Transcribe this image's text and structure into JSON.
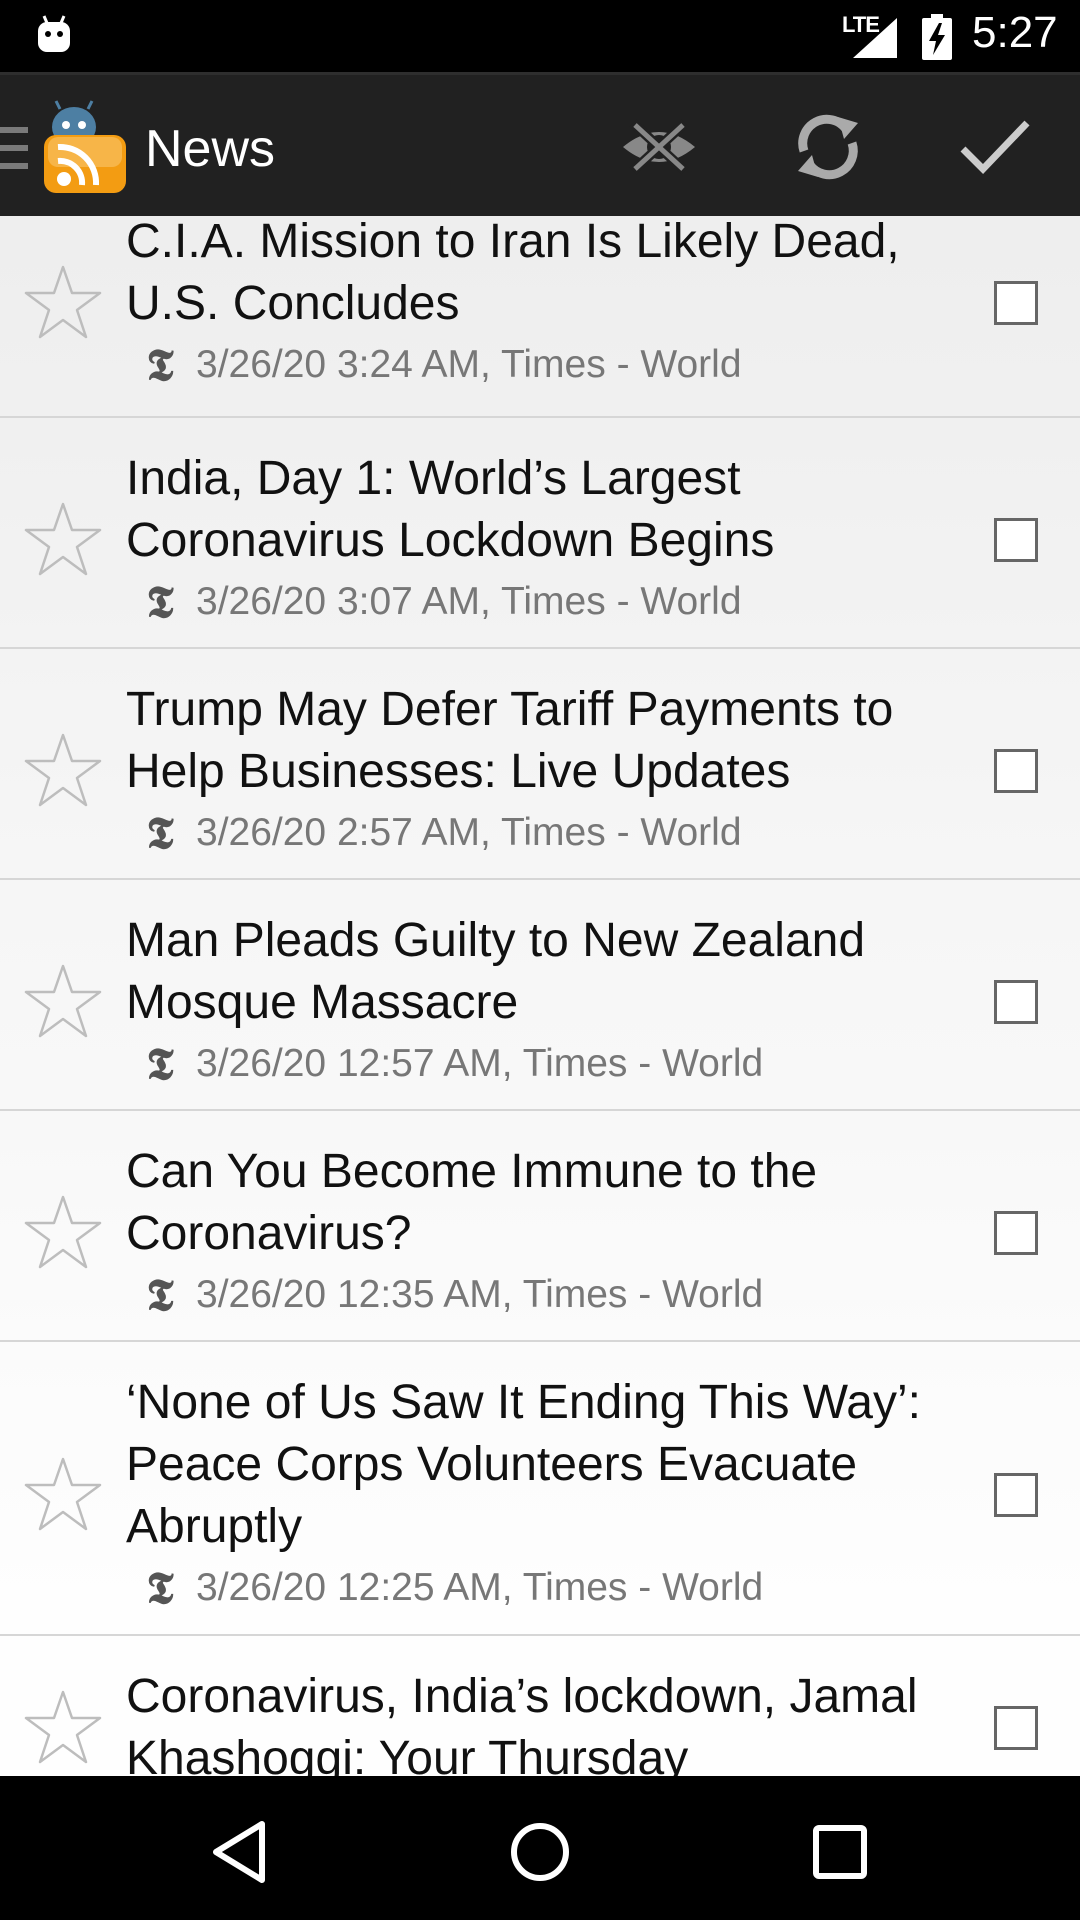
{
  "status_bar": {
    "network": "LTE",
    "time": "5:27",
    "icons": [
      "android-notification-icon",
      "signal-icon",
      "battery-charging-icon"
    ]
  },
  "action_bar": {
    "title": "News",
    "icons": [
      "drawer-menu-icon",
      "rss-app-icon",
      "hide-read-icon",
      "refresh-icon",
      "mark-all-read-icon"
    ]
  },
  "articles": [
    {
      "headline": "C.I.A. Mission to Iran Is Likely Dead, U.S. Concludes",
      "meta": "3/26/20 3:24 AM, Times - World",
      "source_icon": "𝕿",
      "starred": false,
      "checked": false
    },
    {
      "headline": "India, Day 1: World’s Largest Coronavirus Lockdown Begins",
      "meta": "3/26/20 3:07 AM, Times - World",
      "source_icon": "𝕿",
      "starred": false,
      "checked": false
    },
    {
      "headline": "Trump May Defer Tariff Payments to Help Businesses: Live Updates",
      "meta": "3/26/20 2:57 AM, Times - World",
      "source_icon": "𝕿",
      "starred": false,
      "checked": false
    },
    {
      "headline": "Man Pleads Guilty to New Zealand Mosque Massacre",
      "meta": "3/26/20 12:57 AM, Times - World",
      "source_icon": "𝕿",
      "starred": false,
      "checked": false
    },
    {
      "headline": "Can You Become Immune to the Coronavirus?",
      "meta": "3/26/20 12:35 AM, Times - World",
      "source_icon": "𝕿",
      "starred": false,
      "checked": false
    },
    {
      "headline": "‘None of Us Saw It Ending This Way’: Peace Corps Volunteers Evacuate Abruptly",
      "meta": "3/26/20 12:25 AM, Times - World",
      "source_icon": "𝕿",
      "starred": false,
      "checked": false
    },
    {
      "headline": "Coronavirus, India’s lockdown, Jamal Khashoggi: Your Thursday",
      "meta": "",
      "source_icon": "",
      "starred": false,
      "checked": false
    }
  ],
  "nav_bar": {
    "icons": [
      "back-icon",
      "home-icon",
      "recents-icon"
    ]
  },
  "colors": {
    "status_bar": "#000000",
    "action_bar": "#212121",
    "list_bg_top": "#eeeeee",
    "list_bg_bottom": "#ffffff",
    "headline": "#111111",
    "meta": "#777777"
  }
}
